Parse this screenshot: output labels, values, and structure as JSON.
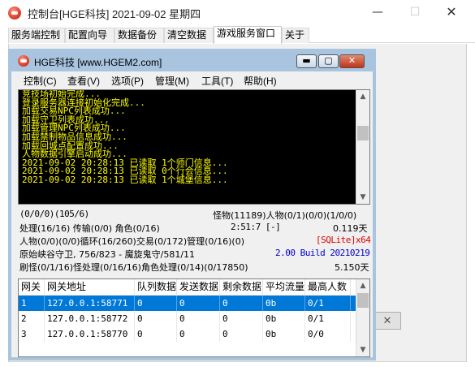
{
  "outer_window": {
    "title": "控制台[HGE科技] 2021-09-02 星期四",
    "minimize": "—",
    "maximize": "☐",
    "close": "✕",
    "small_button": "✕"
  },
  "tabs": [
    {
      "label": "服务端控制"
    },
    {
      "label": "配置向导"
    },
    {
      "label": "数据备份"
    },
    {
      "label": "清空数据"
    },
    {
      "label": "游戏服务窗口",
      "active": true
    },
    {
      "label": "关于"
    }
  ],
  "inner_window": {
    "title": "HGE科技 [www.HGEM2.com]",
    "minimize": "▬",
    "maximize": "▢",
    "close": "✕",
    "menu": [
      "控制(C)",
      "查看(V)",
      "选项(P)",
      "管理(M)",
      "工具(T)",
      "帮助(H)"
    ]
  },
  "log": {
    "text_color": "#ffff00",
    "lines": [
      "竞技场初始完成...",
      "登录服务器连接初始化完成...",
      "加载交易NPC列表成功...",
      "加载守卫列表成功...",
      "加载管理NPC列表成功...",
      "加载禁制物品信息成功...",
      "加载回城点配置成功...",
      "人物数据引擎启动成功...",
      "2021-09-02 20:28:13 已读取 1个师门信息...",
      "2021-09-02 20:28:13 已读取 0个行会信息...",
      "2021-09-02 20:28:13 已读取 1个城堡信息..."
    ]
  },
  "status": {
    "r1_left": "(0/0/0)(105/6)",
    "r1_right": "怪物(11189)人物(0/1)(0/0)(1/0/0)",
    "r2_left": "处理(16/16) 传输(0/0) 角色(0/16)",
    "r2_mid": "2:51:7 [-]",
    "r2_right": "0.119天",
    "r3_left": "人物(0/0)(0/0)循环(16/260)交易(0/172)管理(0/16)(0)",
    "r3_right": "[SQLite]x64",
    "r4_left": "原始峡谷守卫, 756/823 - 魔旋鬼守/581/11",
    "r4_right": "2.00 Build 20210219",
    "r5_left": "刷怪(0/1/16)怪处理(0/16/16)角色处理(0/14)(0/17850)",
    "r5_right": "5.150天",
    "accent_red": "#e00000",
    "accent_blue": "#0000c8"
  },
  "gateway_table": {
    "headers": [
      "网关",
      "网关地址",
      "队列数据",
      "发送数据",
      "剩余数据",
      "平均流量",
      "最高人数"
    ],
    "rows": [
      {
        "cells": [
          "1",
          "127.0.0.1:58771",
          "0",
          "0",
          "0",
          "0b",
          "0/1"
        ],
        "selected": true
      },
      {
        "cells": [
          "2",
          "127.0.0.1:58772",
          "0",
          "0",
          "0",
          "0b",
          "0/1"
        ],
        "selected": false
      },
      {
        "cells": [
          "3",
          "127.0.0.1:58770",
          "0",
          "0",
          "0",
          "0b",
          "0/0"
        ],
        "selected": false
      }
    ],
    "selection_color": "#0078d7"
  }
}
